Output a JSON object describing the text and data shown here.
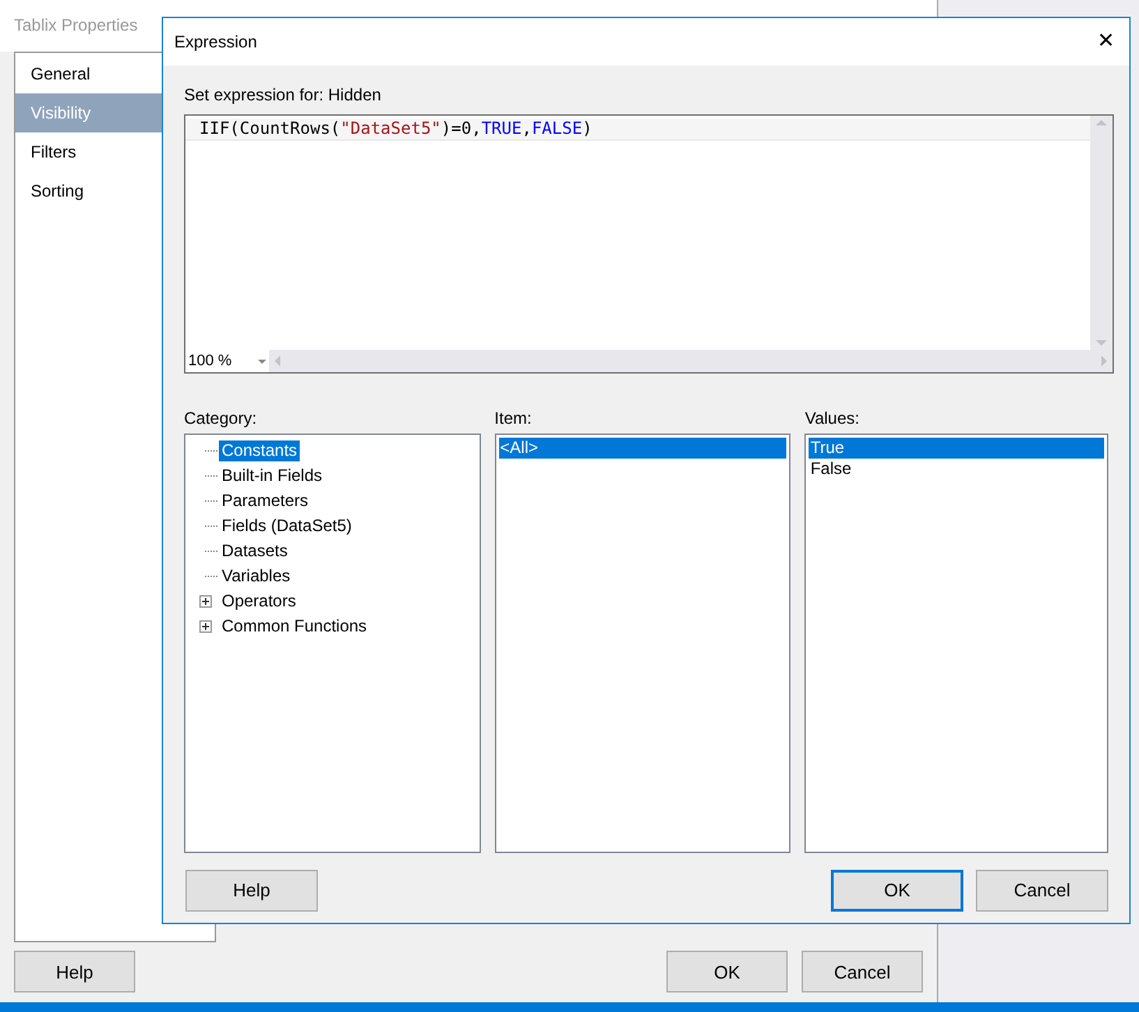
{
  "background_dialog": {
    "title": "Tablix Properties",
    "sidebar": [
      {
        "label": "General",
        "selected": false
      },
      {
        "label": "Visibility",
        "selected": true
      },
      {
        "label": "Filters",
        "selected": false
      },
      {
        "label": "Sorting",
        "selected": false
      }
    ],
    "buttons": {
      "help": "Help",
      "ok": "OK",
      "cancel": "Cancel"
    }
  },
  "expression_dialog": {
    "title": "Expression",
    "close": "✕",
    "prompt": "Set expression for: Hidden",
    "expression": [
      {
        "kind": "plain",
        "text": "IIF(CountRows("
      },
      {
        "kind": "string",
        "text": "\"DataSet5\""
      },
      {
        "kind": "plain",
        "text": ")=0,"
      },
      {
        "kind": "keyword",
        "text": "TRUE"
      },
      {
        "kind": "plain",
        "text": ","
      },
      {
        "kind": "keyword",
        "text": "FALSE"
      },
      {
        "kind": "plain",
        "text": ")"
      }
    ],
    "zoom": "100 %",
    "category": {
      "label": "Category:",
      "items": [
        {
          "label": "Constants",
          "selected": true
        },
        {
          "label": "Built-in Fields",
          "selected": false
        },
        {
          "label": "Parameters",
          "selected": false
        },
        {
          "label": "Fields (DataSet5)",
          "selected": false
        },
        {
          "label": "Datasets",
          "selected": false
        },
        {
          "label": "Variables",
          "selected": false
        },
        {
          "label": "Operators",
          "selected": false,
          "expanded": false
        },
        {
          "label": "Common Functions",
          "selected": false,
          "expanded": false
        }
      ]
    },
    "item": {
      "label": "Item:",
      "items": [
        {
          "label": "<All>",
          "selected": true
        }
      ]
    },
    "values": {
      "label": "Values:",
      "items": [
        {
          "label": "True",
          "selected": true
        },
        {
          "label": "False",
          "selected": false
        }
      ]
    },
    "buttons": {
      "help": "Help",
      "ok": "OK",
      "cancel": "Cancel"
    }
  }
}
